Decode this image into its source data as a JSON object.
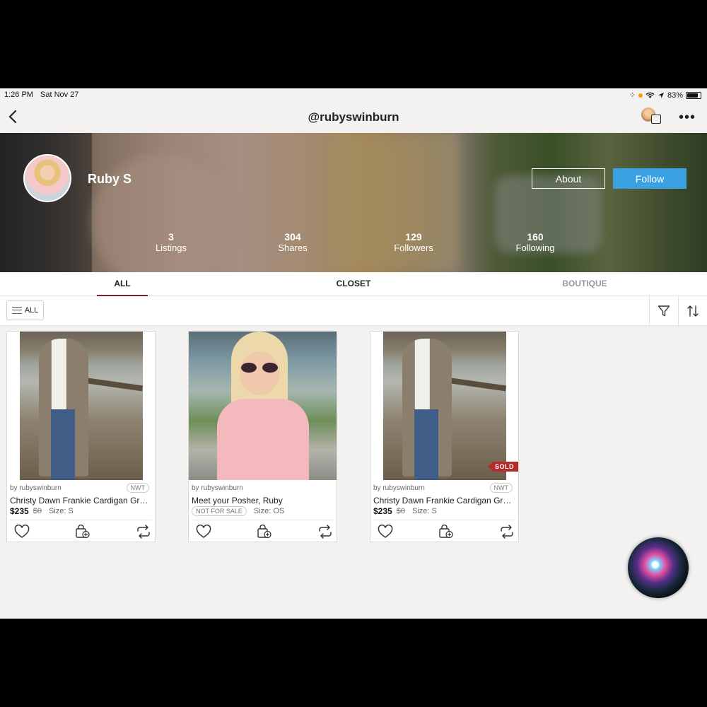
{
  "status_bar": {
    "time": "1:26 PM",
    "date": "Sat Nov 27",
    "battery": "83%",
    "battery_level": 0.83
  },
  "nav": {
    "title": "@rubyswinburn",
    "back_icon": "chevron-left-icon",
    "more_icon": "more-icon"
  },
  "profile": {
    "name": "Ruby S",
    "about_label": "About",
    "follow_label": "Follow",
    "accent": "#3aa2e3",
    "stats": [
      {
        "value": "3",
        "label": "Listings"
      },
      {
        "value": "304",
        "label": "Shares"
      },
      {
        "value": "129",
        "label": "Followers"
      },
      {
        "value": "160",
        "label": "Following"
      }
    ]
  },
  "tabs": [
    {
      "label": "ALL",
      "active": true
    },
    {
      "label": "CLOSET",
      "active": false
    },
    {
      "label": "BOUTIQUE",
      "active": false
    }
  ],
  "filter_bar": {
    "all_label": "ALL"
  },
  "listings": [
    {
      "by": "by rubyswinburn",
      "condition": "NWT",
      "title": "Christy Dawn Frankie Cardigan Gre...",
      "price": "$235",
      "original_price": "$0",
      "size": "Size: S",
      "sold": false
    },
    {
      "by": "by rubyswinburn",
      "title": "Meet your Posher, Ruby",
      "not_for_sale": "NOT FOR SALE",
      "size": "Size: OS"
    },
    {
      "by": "by rubyswinburn",
      "condition": "NWT",
      "title": "Christy Dawn Frankie Cardigan Gre...",
      "price": "$235",
      "original_price": "$0",
      "size": "Size: S",
      "sold_label": "SOLD"
    }
  ]
}
